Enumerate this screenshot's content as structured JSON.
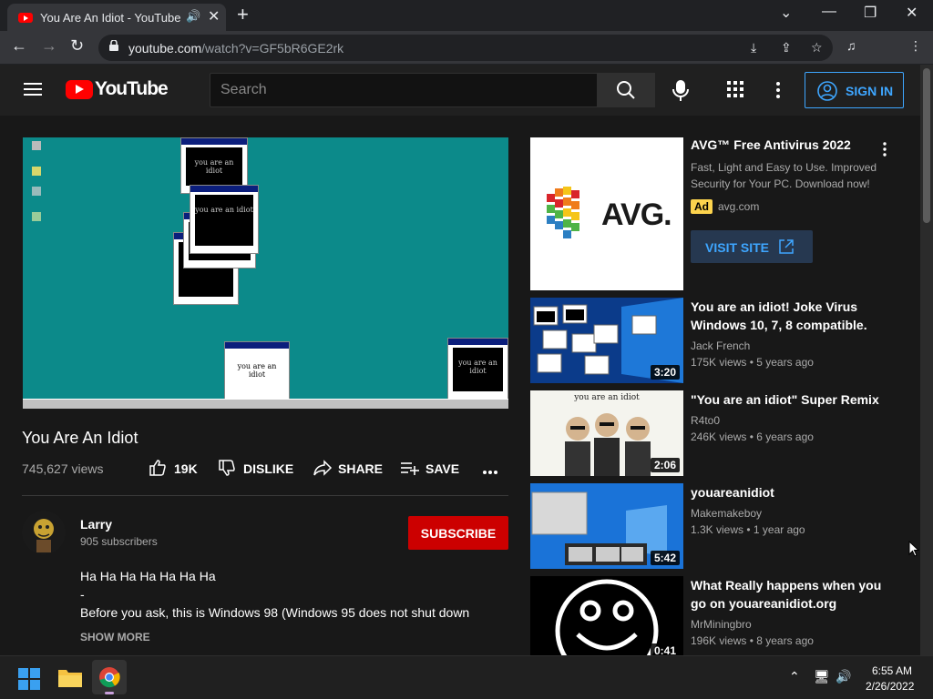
{
  "browser": {
    "tab_title": "You Are An Idiot - YouTube",
    "url_host": "youtube.com",
    "url_path": "/watch?v=GF5bR6GE2rk"
  },
  "masthead": {
    "logo_text": "YouTube",
    "search_placeholder": "Search",
    "signin_label": "SIGN IN"
  },
  "video": {
    "title": "You Are An Idiot",
    "views": "745,627 views",
    "likes": "19K",
    "dislike_label": "DISLIKE",
    "share_label": "SHARE",
    "save_label": "SAVE",
    "player_popup_text": "you are an idiot"
  },
  "channel": {
    "name": "Larry",
    "subscribers": "905 subscribers",
    "subscribe_label": "SUBSCRIBE"
  },
  "description": {
    "line1": "Ha Ha Ha Ha Ha Ha Ha",
    "line2": "-",
    "line3": "Before you ask, this is Windows 98 (Windows 95 does not shut down",
    "show_more": "SHOW MORE"
  },
  "ad": {
    "title": "AVG™ Free Antivirus 2022",
    "description": "Fast, Light and Easy to Use. Improved Security for Your PC. Download now!",
    "badge": "Ad",
    "domain": "avg.com",
    "cta": "VISIT SITE",
    "logo_text": "AVG."
  },
  "recommendations": [
    {
      "title": "You are an idiot! Joke Virus Windows 10, 7, 8 compatible.",
      "channel": "Jack French",
      "meta": "175K views • 5 years ago",
      "duration": "3:20"
    },
    {
      "title": "\"You are an idiot\" Super Remix",
      "channel": "R4to0",
      "meta": "246K views • 6 years ago",
      "duration": "2:06",
      "thumb_caption": "you are an idiot"
    },
    {
      "title": "youareanidiot",
      "channel": "Makemakeboy",
      "meta": "1.3K views • 1 year ago",
      "duration": "5:42"
    },
    {
      "title": "What Really happens when you go on youareanidiot.org",
      "channel": "MrMiningbro",
      "meta": "196K views • 8 years ago",
      "duration": "0:41"
    }
  ],
  "taskbar": {
    "time": "6:55 AM",
    "date": "2/26/2022"
  },
  "colors": {
    "brand_red": "#ff0000",
    "accent_blue": "#3ea6ff",
    "subscribe_red": "#cc0000",
    "player_teal": "#0c8a8a"
  }
}
